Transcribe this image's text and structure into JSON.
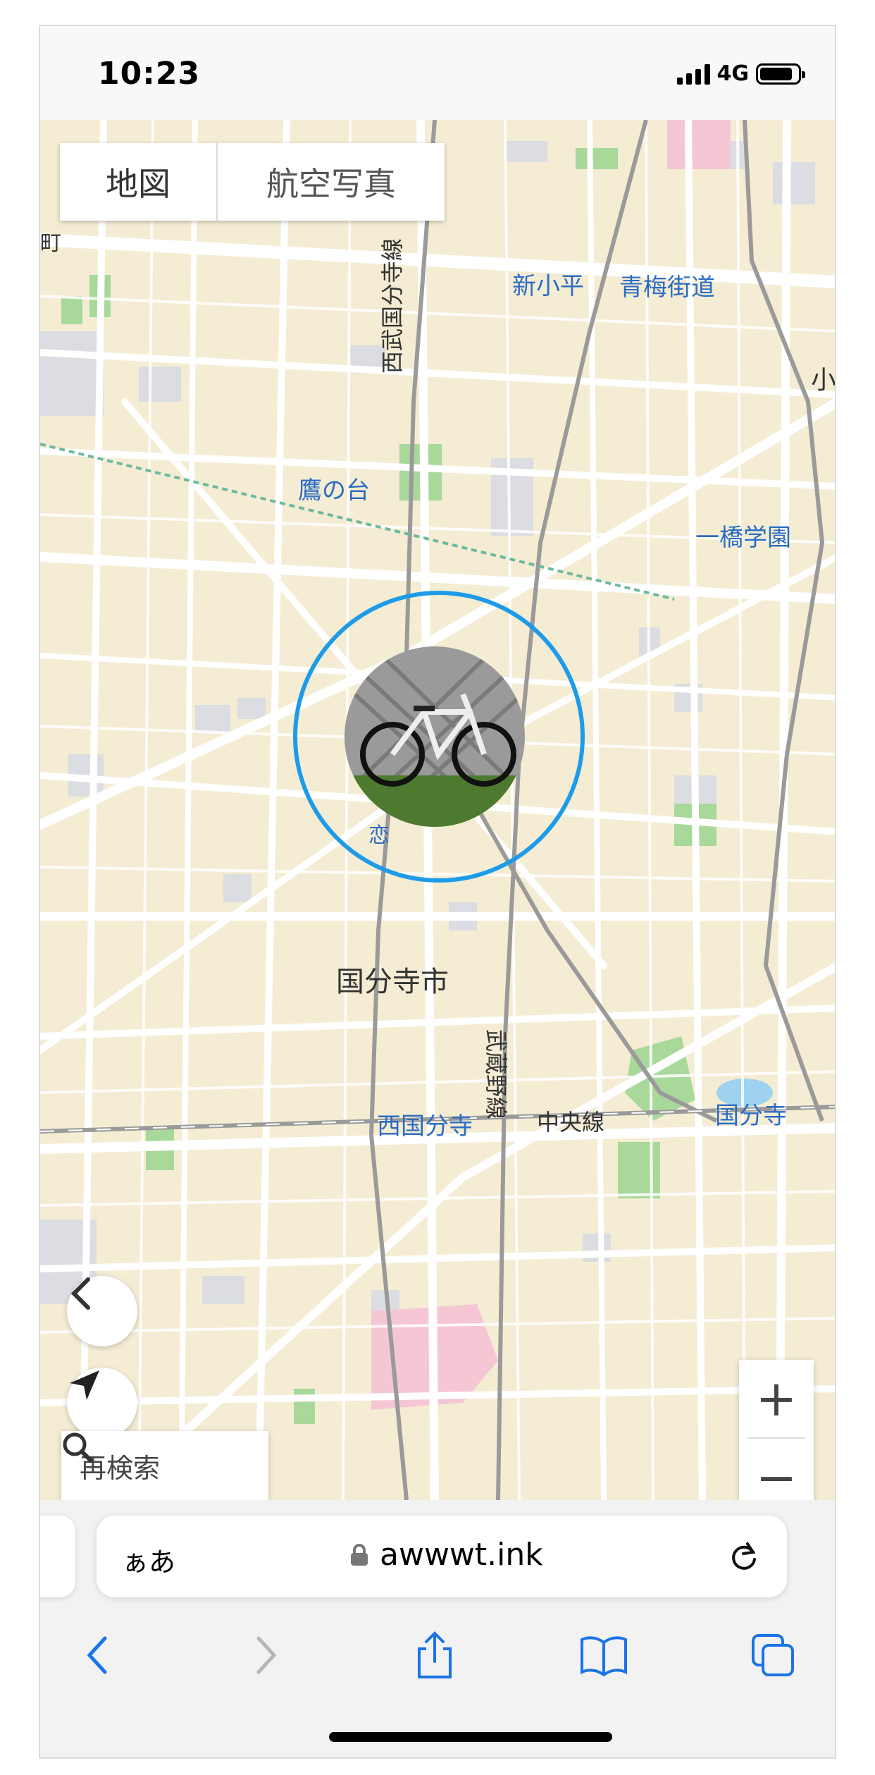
{
  "status_bar": {
    "time": "10:23",
    "network": "4G"
  },
  "map_type": {
    "map_label": "地図",
    "aerial_label": "航空写真"
  },
  "map_labels": {
    "station_shinkodaira": "新小平",
    "station_omekaido": "青梅街道",
    "line_seibu_kokubunji": "西武国分寺線",
    "station_takanodai": "鷹の台",
    "station_hitotsubashi": "一橋学園",
    "city_kokubunji": "国分寺市",
    "line_musashino": "武蔵野線",
    "station_nishikokubunji": "西国分寺",
    "line_chuo": "中央線",
    "station_kokubunji": "国分寺",
    "partial_left": "町",
    "partial_right": "小",
    "partial_under_pin": "恋"
  },
  "controls": {
    "research_label": "再検索",
    "zoom_in": "+",
    "zoom_out": "−"
  },
  "browser": {
    "text_size": "ぁあ",
    "url": "awwwt.ink"
  },
  "icons": [
    "back-icon",
    "locate-icon",
    "search-icon",
    "lock-icon",
    "reload-icon",
    "nav-back-icon",
    "nav-forward-icon",
    "share-icon",
    "bookmarks-icon",
    "tabs-icon"
  ],
  "colors": {
    "accent": "#1e9be8",
    "map_bg": "#f4ecd3",
    "link_blue": "#2b6cc4"
  }
}
